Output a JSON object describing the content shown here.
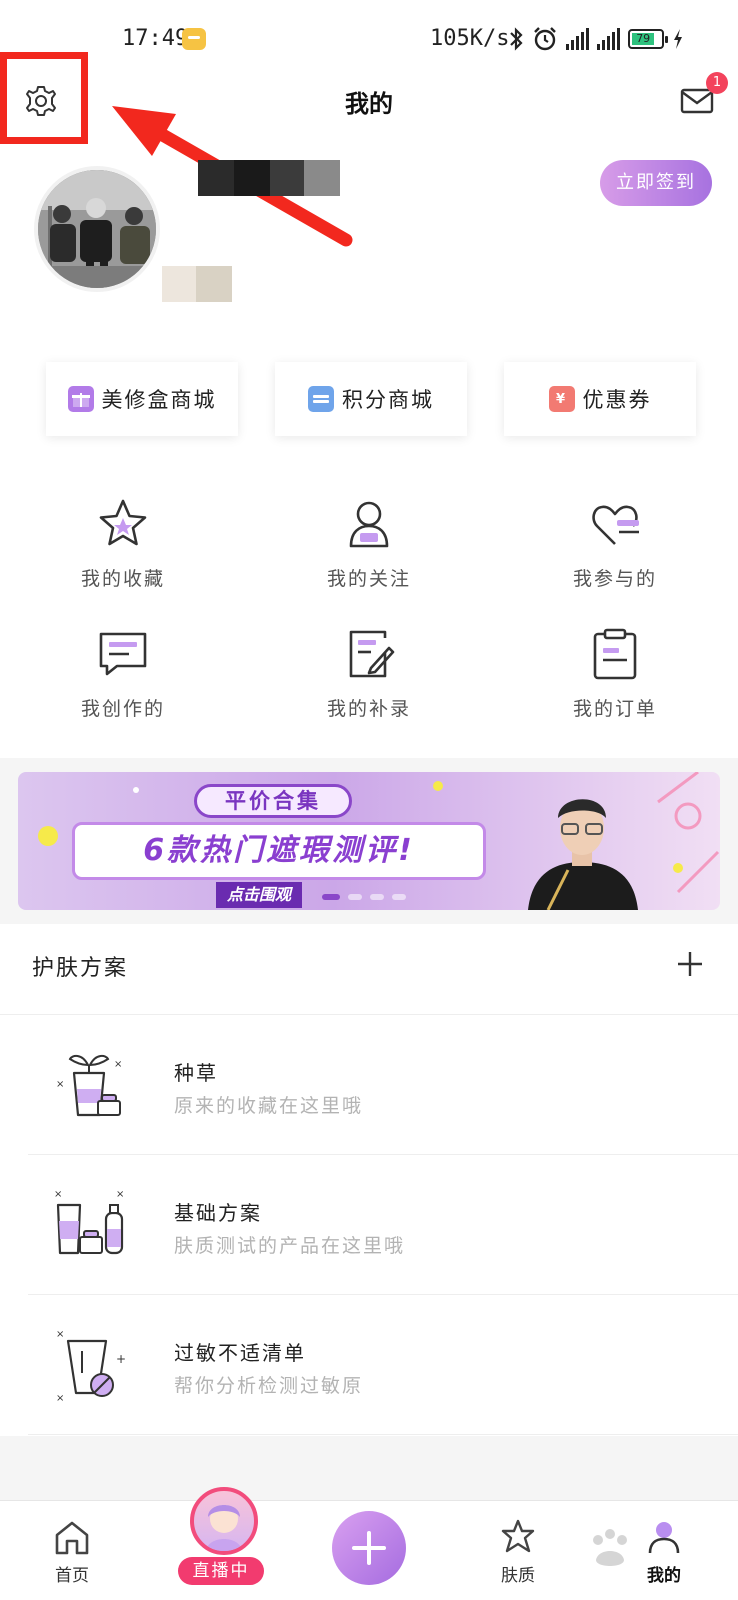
{
  "status_bar": {
    "time": "17:49",
    "speed": "105K/s",
    "battery": "79"
  },
  "header": {
    "title": "我的",
    "mail_badge": "1"
  },
  "profile": {
    "signin_label": "立即签到"
  },
  "shop": [
    {
      "label": "美修盒商城",
      "icon": "gift-icon",
      "color": "#b27be8"
    },
    {
      "label": "积分商城",
      "icon": "points-icon",
      "color": "#6fa4ea"
    },
    {
      "label": "优惠券",
      "icon": "coupon-icon",
      "color": "#f27a72",
      "glyph": "¥"
    }
  ],
  "features": [
    {
      "label": "我的收藏",
      "icon": "star-icon"
    },
    {
      "label": "我的关注",
      "icon": "person-icon"
    },
    {
      "label": "我参与的",
      "icon": "heart-chat-icon"
    },
    {
      "label": "我创作的",
      "icon": "chat-bubble-icon"
    },
    {
      "label": "我的补录",
      "icon": "edit-note-icon"
    },
    {
      "label": "我的订单",
      "icon": "clipboard-icon"
    }
  ],
  "banner": {
    "tag": "平价合集",
    "headline": "6款热门遮瑕测评!",
    "cta": "点击围观"
  },
  "skincare": {
    "title": "护肤方案",
    "items": [
      {
        "title": "种草",
        "subtitle": "原来的收藏在这里哦",
        "icon": "plant-bottle-icon"
      },
      {
        "title": "基础方案",
        "subtitle": "肤质测试的产品在这里哦",
        "icon": "bottles-icon"
      },
      {
        "title": "过敏不适清单",
        "subtitle": "帮你分析检测过敏原",
        "icon": "allergy-tube-icon"
      }
    ]
  },
  "tabbar": {
    "home": "首页",
    "live": "直播中",
    "skin": "肤质",
    "mine": "我的"
  },
  "colors": {
    "accent": "#a772e0",
    "annotation": "#f2281e",
    "live": "#f23b6f"
  }
}
